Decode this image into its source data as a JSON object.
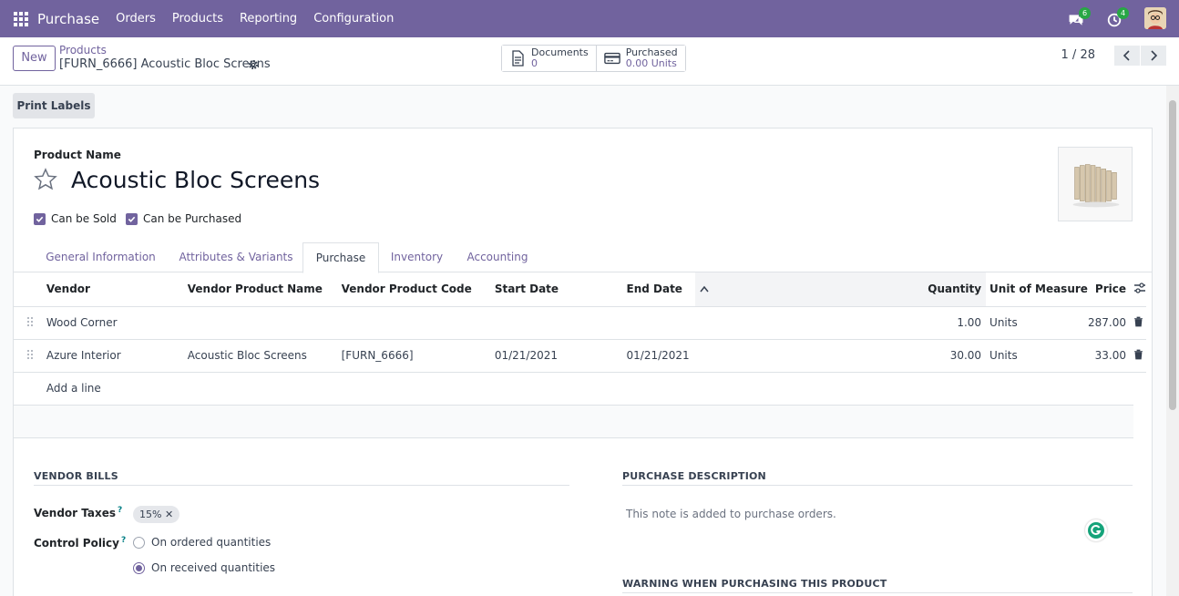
{
  "navbar": {
    "app_name": "Purchase",
    "menu": [
      "Orders",
      "Products",
      "Reporting",
      "Configuration"
    ],
    "messages_count": "6",
    "activities_count": "4",
    "color": "#71639e"
  },
  "control": {
    "new_label": "New",
    "breadcrumb_parent": "Products",
    "breadcrumb_current": "[FURN_6666] Acoustic Bloc Screens",
    "stats": [
      {
        "label": "Documents",
        "value": "0",
        "icon": "document-icon"
      },
      {
        "label": "Purchased",
        "value": "0.00 Units",
        "icon": "credit-card-icon"
      }
    ],
    "pager": "1 / 28"
  },
  "form": {
    "print_labels": "Print Labels",
    "product_name_label": "Product Name",
    "product_name": "Acoustic Bloc Screens",
    "can_be_sold": "Can be Sold",
    "can_be_purchased": "Can be Purchased",
    "tabs": [
      "General Information",
      "Attributes & Variants",
      "Purchase",
      "Inventory",
      "Accounting"
    ],
    "active_tab": "Purchase"
  },
  "vendors_table": {
    "columns": [
      "Vendor",
      "Vendor Product Name",
      "Vendor Product Code",
      "Start Date",
      "End Date",
      "Quantity",
      "Unit of Measure",
      "Price"
    ],
    "rows": [
      {
        "vendor": "Wood Corner",
        "product_name": "",
        "product_code": "",
        "start_date": "",
        "end_date": "",
        "quantity": "1.00",
        "uom": "Units",
        "price": "287.00"
      },
      {
        "vendor": "Azure Interior",
        "product_name": "Acoustic Bloc Screens",
        "product_code": "[FURN_6666]",
        "start_date": "01/21/2021",
        "end_date": "01/21/2021",
        "quantity": "30.00",
        "uom": "Units",
        "price": "33.00"
      }
    ],
    "add_line": "Add a line"
  },
  "vendor_bills": {
    "title": "VENDOR BILLS",
    "taxes_label": "Vendor Taxes",
    "taxes_tag": "15%",
    "control_policy_label": "Control Policy",
    "help_mark": "?",
    "options": [
      "On ordered quantities",
      "On received quantities"
    ],
    "selected_option": "On received quantities"
  },
  "purchase_description": {
    "title": "PURCHASE DESCRIPTION",
    "placeholder": "This note is added to purchase orders.",
    "warning_title": "WARNING WHEN PURCHASING THIS PRODUCT"
  }
}
